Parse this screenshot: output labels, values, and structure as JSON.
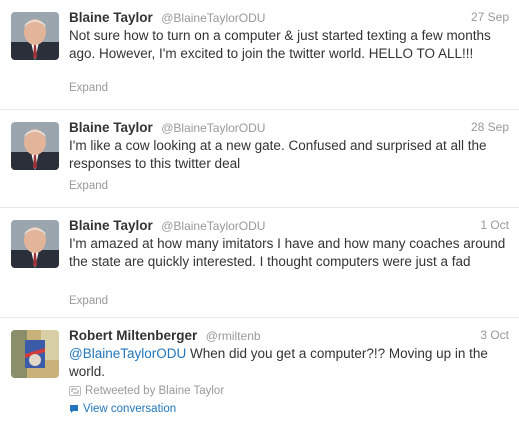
{
  "tweets": [
    {
      "name": "Blaine Taylor",
      "handle": "@BlaineTaylorODU",
      "date": "27 Sep",
      "text": "Not sure how to turn on a computer & just started texting a few months ago. However, I'm excited to join the twitter world. HELLO TO ALL!!!",
      "expand": "Expand"
    },
    {
      "name": "Blaine Taylor",
      "handle": "@BlaineTaylorODU",
      "date": "28 Sep",
      "text": "I'm like a cow looking at a new gate. Confused and surprised at all the responses to this twitter deal",
      "expand": "Expand"
    },
    {
      "name": "Blaine Taylor",
      "handle": "@BlaineTaylorODU",
      "date": "1 Oct",
      "text": "I'm amazed at how many imitators I have and how many coaches around the state are quickly interested. I thought computers were just a fad",
      "expand": "Expand"
    },
    {
      "name": "Robert Miltenberger",
      "handle": "@rmiltenb",
      "date": "3 Oct",
      "mention": "@BlaineTaylorODU",
      "text": " When did you get a computer?!? Moving up in the world.",
      "retweeted": "Retweeted by Blaine Taylor",
      "view_conversation": "View conversation"
    }
  ],
  "icons": {
    "retweet": "retweet-icon",
    "conversation": "speech-bubble-icon"
  },
  "colors": {
    "link": "#2276bb",
    "muted": "#999999",
    "text": "#333333"
  }
}
